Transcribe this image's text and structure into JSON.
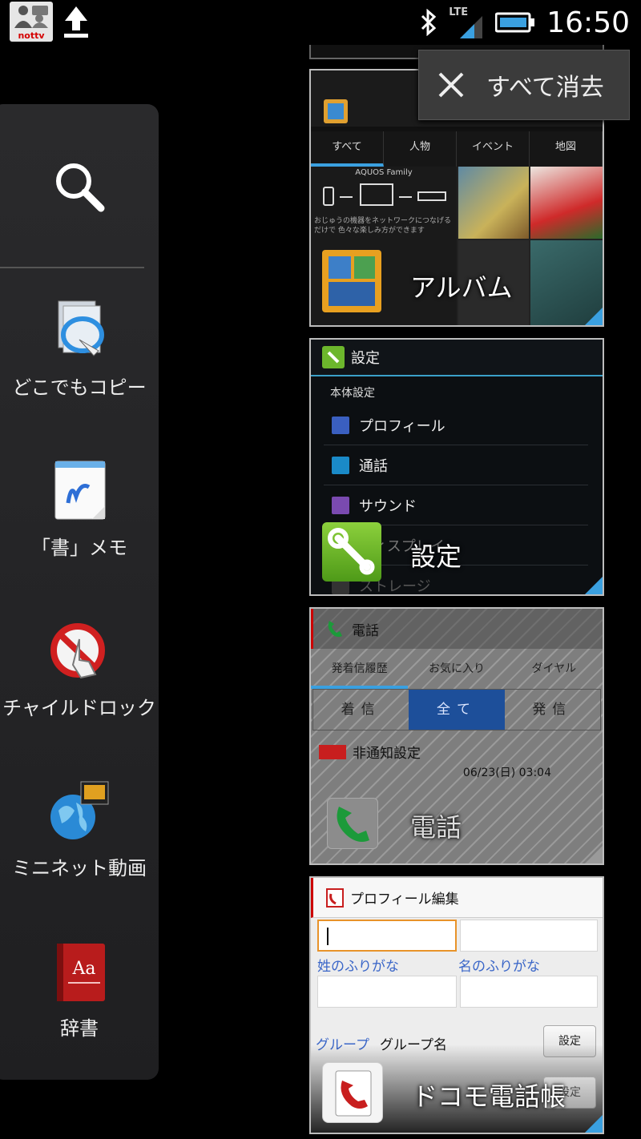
{
  "status_bar": {
    "app_badge": "nottv",
    "network": "LTE",
    "time": "16:50"
  },
  "recents_overlay": {
    "clear_all_label": "すべて消去"
  },
  "side_panel": {
    "items": [
      {
        "label": "どこでもコピー",
        "icon": "copy-anywhere-icon"
      },
      {
        "label": "「書」メモ",
        "icon": "memo-icon"
      },
      {
        "label": "チャイルドロック",
        "icon": "child-lock-icon"
      },
      {
        "label": "ミニネット動画",
        "icon": "mini-net-video-icon"
      },
      {
        "label": "辞書",
        "icon": "dictionary-icon"
      }
    ]
  },
  "recent_apps": [
    {
      "name": "アルバム",
      "preview": {
        "tabs": [
          "すべて",
          "人物",
          "イベント",
          "地図"
        ],
        "banner_title": "AQUOS Family",
        "banner_text": "おじゅうの機器をネットワークにつなげるだけで 色々な楽しみ方ができます"
      }
    },
    {
      "name": "設定",
      "preview": {
        "title": "設定",
        "section": "本体設定",
        "rows": [
          "プロフィール",
          "通話",
          "サウンド",
          "ディスプレイ",
          "ストレージ"
        ]
      }
    },
    {
      "name": "電話",
      "preview": {
        "title": "電話",
        "tabs": [
          "発着信履歴",
          "お気に入り",
          "ダイヤル"
        ],
        "segments": [
          "着信",
          "全て",
          "発信"
        ],
        "entry_name": "非通知設定",
        "entry_time": "06/23(日) 03:04"
      }
    },
    {
      "name": "ドコモ電話帳",
      "preview": {
        "title": "プロフィール編集",
        "label_last": "姓のふりがな",
        "label_first": "名のふりがな",
        "group_label": "グループ",
        "group_value": "グループ名",
        "set_button": "設定",
        "set_button_2": "設定"
      }
    }
  ]
}
